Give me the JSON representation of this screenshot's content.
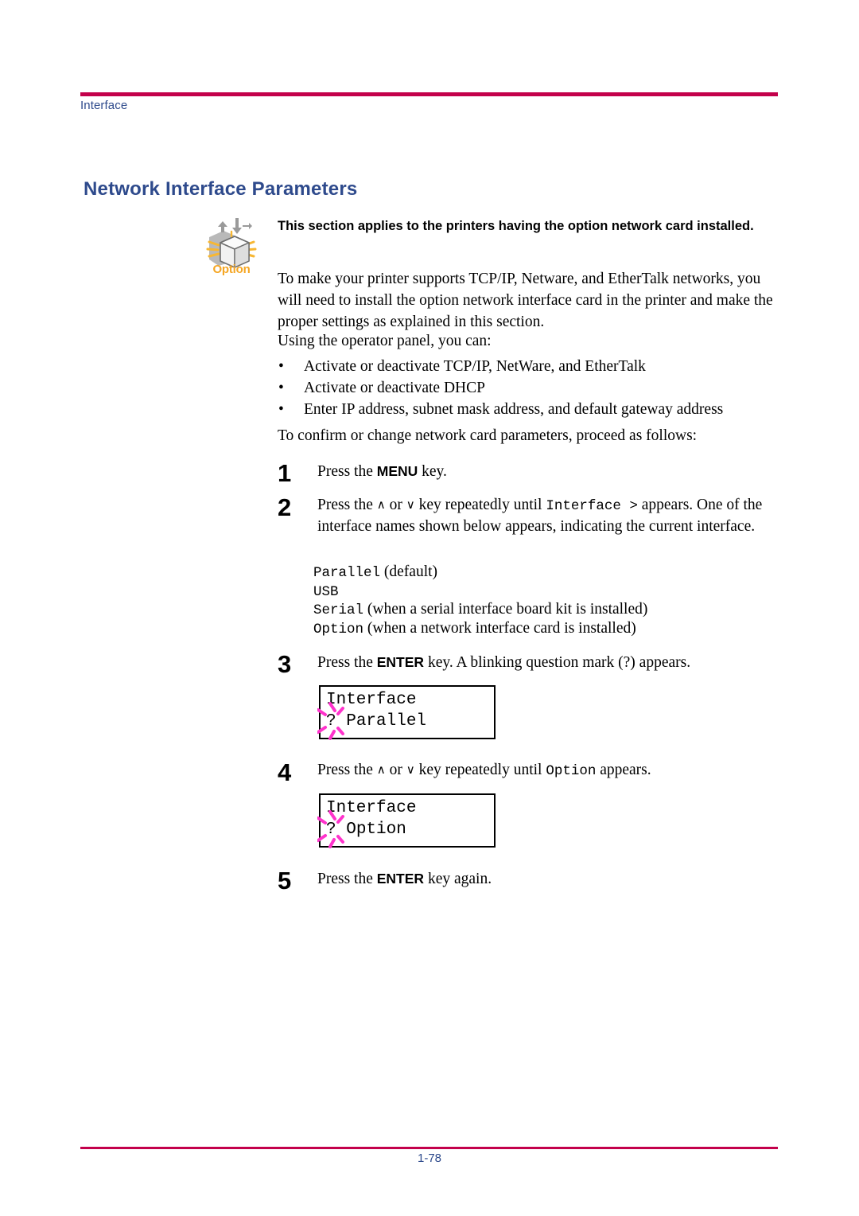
{
  "header": {
    "running_head": "Interface",
    "rule_color": "#C3014B",
    "text_color": "#2E4A8C"
  },
  "section": {
    "title": "Network Interface Parameters",
    "title_color": "#2E4A8C"
  },
  "option_note": {
    "icon_label": "Option",
    "icon_label_color": "#F5A623",
    "text": "This section applies to the printers having the option network card installed."
  },
  "body": {
    "intro": "To make your printer supports TCP/IP, Netware, and EtherTalk networks, you will need to install the option network interface card in the printer and make the proper settings as explained in this section.",
    "using_lead": "Using the operator panel, you can:",
    "bullets": [
      "Activate or deactivate TCP/IP, NetWare, and EtherTalk",
      "Activate or deactivate DHCP",
      "Enter IP address, subnet mask address, and default gateway address"
    ],
    "bullet_glyph": "•",
    "confirm_lead": "To confirm or change network card parameters, proceed as follows:"
  },
  "steps": [
    {
      "number": "1",
      "pre": "Press the ",
      "key": "MENU",
      "post": " key."
    },
    {
      "number": "2",
      "pre": "Press the ",
      "up": "∧",
      "mid": " or ",
      "down": "∨",
      "after_keys": " key repeatedly until ",
      "mono": "Interface >",
      "post": " appears. One of the interface names shown below appears, indicating the current interface."
    },
    {
      "number": "3",
      "pre": "Press the ",
      "key": "ENTER",
      "post": " key. A blinking question mark (?) appears."
    },
    {
      "number": "4",
      "pre": "Press the ",
      "up": "∧",
      "mid": " or ",
      "down": "∨",
      "after_keys": " key repeatedly until ",
      "mono": "Option",
      "post": " appears."
    },
    {
      "number": "5",
      "pre": "Press the ",
      "key": "ENTER",
      "post": " key again."
    }
  ],
  "interface_list": [
    {
      "name": "Parallel",
      "note": "(default)"
    },
    {
      "name": "USB",
      "note": ""
    },
    {
      "name": "Serial",
      "note": "(when a serial interface board kit is installed)"
    },
    {
      "name": "Option",
      "note": "(when a network interface card is installed)"
    }
  ],
  "lcd_panels": [
    {
      "line1": "Interface",
      "prompt": "?",
      "value": "Parallel",
      "blink_color": "#FF33CC"
    },
    {
      "line1": "Interface",
      "prompt": "?",
      "value": "Option",
      "blink_color": "#FF33CC"
    }
  ],
  "footer": {
    "page_number": "1-78",
    "rule_color": "#C3014B",
    "text_color": "#2E4A8C"
  }
}
